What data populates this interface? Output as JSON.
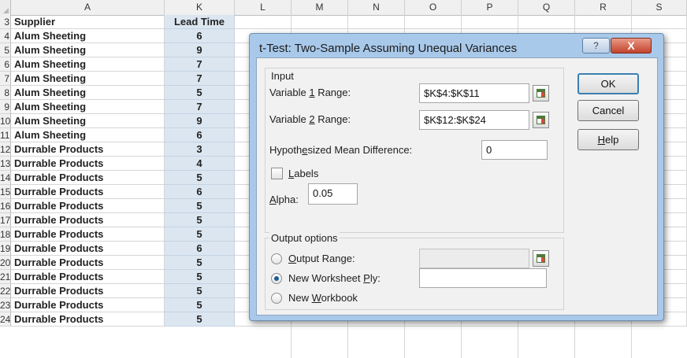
{
  "spreadsheet": {
    "columns": [
      "A",
      "K",
      "L",
      "M",
      "N",
      "O",
      "P",
      "Q",
      "R",
      "S"
    ],
    "header_row": {
      "num": "3",
      "supplier": "Supplier",
      "lead_time": "Lead Time"
    },
    "rows": [
      {
        "num": "4",
        "supplier": "Alum Sheeting",
        "lead_time": "6"
      },
      {
        "num": "5",
        "supplier": "Alum Sheeting",
        "lead_time": "9"
      },
      {
        "num": "6",
        "supplier": "Alum Sheeting",
        "lead_time": "7"
      },
      {
        "num": "7",
        "supplier": "Alum Sheeting",
        "lead_time": "7"
      },
      {
        "num": "8",
        "supplier": "Alum Sheeting",
        "lead_time": "5"
      },
      {
        "num": "9",
        "supplier": "Alum Sheeting",
        "lead_time": "7"
      },
      {
        "num": "10",
        "supplier": "Alum Sheeting",
        "lead_time": "9"
      },
      {
        "num": "11",
        "supplier": "Alum Sheeting",
        "lead_time": "6"
      },
      {
        "num": "12",
        "supplier": "Durrable Products",
        "lead_time": "3"
      },
      {
        "num": "13",
        "supplier": "Durrable Products",
        "lead_time": "4"
      },
      {
        "num": "14",
        "supplier": "Durrable Products",
        "lead_time": "5"
      },
      {
        "num": "15",
        "supplier": "Durrable Products",
        "lead_time": "6"
      },
      {
        "num": "16",
        "supplier": "Durrable Products",
        "lead_time": "5"
      },
      {
        "num": "17",
        "supplier": "Durrable Products",
        "lead_time": "5"
      },
      {
        "num": "18",
        "supplier": "Durrable Products",
        "lead_time": "5"
      },
      {
        "num": "19",
        "supplier": "Durrable Products",
        "lead_time": "6"
      },
      {
        "num": "20",
        "supplier": "Durrable Products",
        "lead_time": "5"
      },
      {
        "num": "21",
        "supplier": "Durrable Products",
        "lead_time": "5"
      },
      {
        "num": "22",
        "supplier": "Durrable Products",
        "lead_time": "5"
      },
      {
        "num": "23",
        "supplier": "Durrable Products",
        "lead_time": "5"
      },
      {
        "num": "24",
        "supplier": "Durrable Products",
        "lead_time": "5"
      }
    ]
  },
  "dialog": {
    "title": "t-Test: Two-Sample Assuming Unequal Variances",
    "help_icon_glyph": "?",
    "close_icon_glyph": "X",
    "input_group_label": "Input",
    "var1": {
      "pre": "Variable ",
      "key": "1",
      "post": " Range:",
      "value": "$K$4:$K$11"
    },
    "var2": {
      "pre": "Variable ",
      "key": "2",
      "post": " Range:",
      "value": "$K$12:$K$24"
    },
    "hyp": {
      "pre": "Hypoth",
      "key": "e",
      "post": "sized Mean Difference:",
      "value": "0"
    },
    "labels": {
      "key": "L",
      "post": "abels",
      "checked": false
    },
    "alpha": {
      "key": "A",
      "post": "lpha:",
      "value": "0.05"
    },
    "output_group_label": "Output options",
    "output_range": {
      "key": "O",
      "post": "utput Range:",
      "value": "",
      "selected": false
    },
    "new_ply": {
      "pre": "New Worksheet ",
      "key": "P",
      "post": "ly:",
      "value": "",
      "selected": true
    },
    "new_workbook": {
      "pre": "New ",
      "key": "W",
      "post": "orkbook",
      "selected": false
    },
    "ok_label": "OK",
    "cancel_label": "Cancel",
    "help": {
      "key": "H",
      "post": "elp"
    }
  },
  "colors": {
    "selected_column": "#dbe6f1",
    "dialog_frame": "#a9c9ea",
    "close_red": "#c2432d",
    "default_button_border": "#3c7fb1"
  },
  "icons": [
    "range-selector-icon",
    "help-icon",
    "close-icon"
  ]
}
